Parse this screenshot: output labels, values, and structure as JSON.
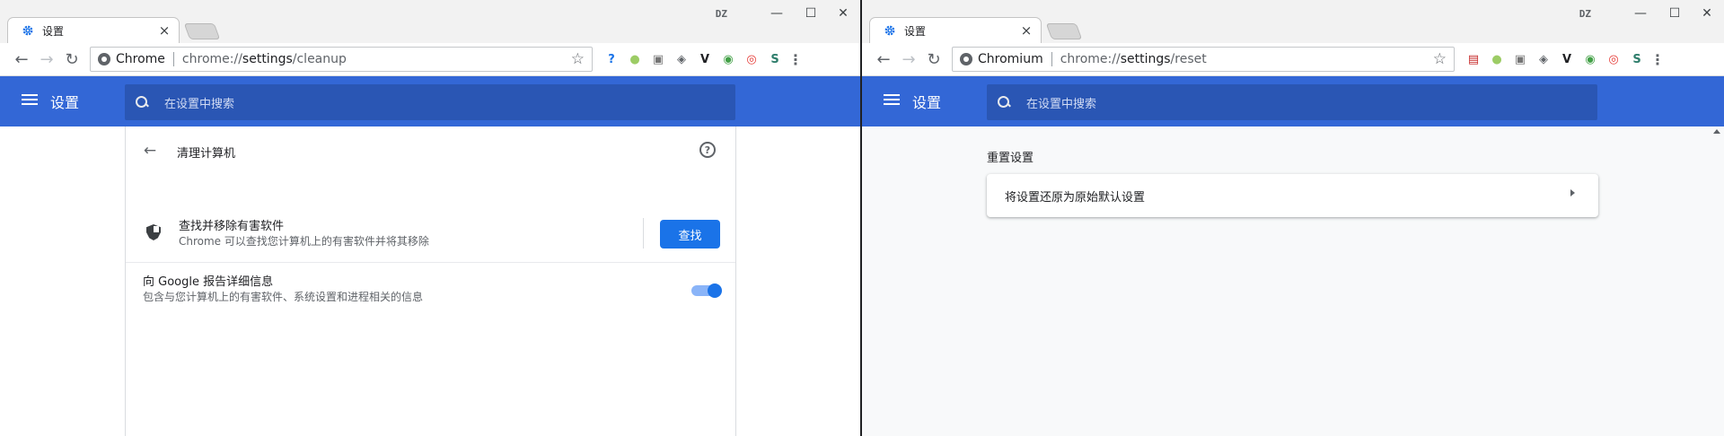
{
  "left_window": {
    "tab_title": "设置",
    "tab_close": "×",
    "profile_badge": "DZ",
    "controls": {
      "minimize": "—",
      "maximize": "☐",
      "close": "✕"
    },
    "toolbar": {
      "back": "←",
      "forward": "→",
      "reload": "↻",
      "origin": "Chrome",
      "url_prefix": "chrome://",
      "url_host": "settings",
      "url_path": "/cleanup",
      "star": "☆",
      "extensions": [
        {
          "icon": "help-question-icon",
          "glyph": "?",
          "color": "#1a73e8"
        },
        {
          "icon": "green-circle-icon",
          "glyph": "●",
          "color": "#9ccc65"
        },
        {
          "icon": "gamepad-icon",
          "glyph": "▣",
          "color": "#757575"
        },
        {
          "icon": "ublock-shield-icon",
          "glyph": "◈",
          "color": "#5f6368"
        },
        {
          "icon": "v-icon",
          "glyph": "V",
          "color": "#202124"
        },
        {
          "icon": "globe-icon",
          "glyph": "◉",
          "color": "#43a047"
        },
        {
          "icon": "weibo-icon",
          "glyph": "◎",
          "color": "#e53935"
        },
        {
          "icon": "s-icon",
          "glyph": "S",
          "color": "#2e7d6b"
        }
      ],
      "menu": "⋮"
    },
    "header": {
      "menu_title": "设置",
      "search_placeholder": "在设置中搜索"
    },
    "cleanup": {
      "back": "←",
      "title": "清理计算机",
      "help": "?",
      "find_title": "查找并移除有害软件",
      "find_desc": "Chrome 可以查找您计算机上的有害软件并将其移除",
      "find_button": "查找",
      "report_title": "向 Google 报告详细信息",
      "report_desc": "包含与您计算机上的有害软件、系统设置和进程相关的信息",
      "report_enabled": true
    }
  },
  "right_window": {
    "tab_title": "设置",
    "tab_close": "×",
    "profile_badge": "DZ",
    "controls": {
      "minimize": "—",
      "maximize": "☐",
      "close": "✕"
    },
    "toolbar": {
      "back": "←",
      "forward": "→",
      "reload": "↻",
      "origin": "Chromium",
      "url_prefix": "chrome://",
      "url_host": "settings",
      "url_path": "/reset",
      "star": "☆",
      "extensions": [
        {
          "icon": "us-flag-icon",
          "glyph": "▤",
          "color": "#c62828"
        },
        {
          "icon": "green-circle-icon",
          "glyph": "●",
          "color": "#9ccc65"
        },
        {
          "icon": "gamepad-icon",
          "glyph": "▣",
          "color": "#757575"
        },
        {
          "icon": "ublock-shield-icon",
          "glyph": "◈",
          "color": "#5f6368"
        },
        {
          "icon": "v-icon",
          "glyph": "V",
          "color": "#202124"
        },
        {
          "icon": "globe-icon",
          "glyph": "◉",
          "color": "#43a047"
        },
        {
          "icon": "weibo-icon",
          "glyph": "◎",
          "color": "#e53935"
        },
        {
          "icon": "s-icon",
          "glyph": "S",
          "color": "#2e7d6b"
        }
      ],
      "menu": "⋮"
    },
    "header": {
      "menu_title": "设置",
      "search_placeholder": "在设置中搜索"
    },
    "reset": {
      "section_title": "重置设置",
      "item_label": "将设置还原为原始默认设置"
    }
  },
  "colors": {
    "header_blue": "#3367d6",
    "search_blue": "#2a56b4",
    "button_blue": "#1a73e8",
    "toggle_track": "#8ab4f8"
  }
}
